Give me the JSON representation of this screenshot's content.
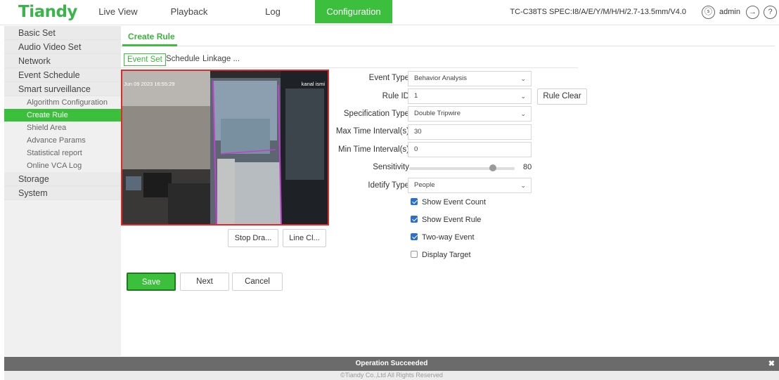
{
  "brand": {
    "logo": "Tiandy"
  },
  "nav": {
    "tabs": [
      {
        "label": "Live View"
      },
      {
        "label": "Playback"
      },
      {
        "label": "Log"
      },
      {
        "label": "Configuration"
      }
    ]
  },
  "header": {
    "device": "TC-C38TS SPEC:I8/A/E/Y/M/H/H/2.7-13.5mm/V4.0",
    "user": "admin"
  },
  "sidebar": {
    "items": [
      {
        "label": "Basic Set"
      },
      {
        "label": "Audio Video Set"
      },
      {
        "label": "Network"
      },
      {
        "label": "Event Schedule"
      },
      {
        "label": "Smart surveillance"
      }
    ],
    "subitems": [
      {
        "label": "Algorithm Configuration"
      },
      {
        "label": "Create Rule"
      },
      {
        "label": "Shield Area"
      },
      {
        "label": "Advance Params"
      },
      {
        "label": "Statistical report"
      },
      {
        "label": "Online VCA Log"
      }
    ],
    "bottom": [
      {
        "label": "Storage"
      },
      {
        "label": "System"
      }
    ]
  },
  "page": {
    "title": "Create Rule",
    "subtabs": [
      {
        "label": "Event Set"
      },
      {
        "label": "Schedule"
      },
      {
        "label": "Linkage ..."
      }
    ]
  },
  "video": {
    "timestamp": "Jun 09 2023 16:55:29",
    "channel_name": "kanal ismi"
  },
  "video_buttons": {
    "stop_draw": "Stop Dra...",
    "line_clear": "Line Cl..."
  },
  "form": {
    "event_type": {
      "label": "Event Type",
      "value": "Behavior Analysis"
    },
    "rule_id": {
      "label": "Rule ID",
      "value": "1"
    },
    "rule_clear": "Rule Clear",
    "spec_type": {
      "label": "Specification Type",
      "value": "Double Tripwire"
    },
    "max_interval": {
      "label": "Max Time Interval(s)",
      "value": "30"
    },
    "min_interval": {
      "label": "Min Time Interval(s)",
      "value": "0"
    },
    "sensitivity": {
      "label": "Sensitivity",
      "value": "80"
    },
    "identify_type": {
      "label": "Idetify Type",
      "value": "People"
    },
    "checks": [
      {
        "label": "Show Event Count",
        "checked": true
      },
      {
        "label": "Show Event Rule",
        "checked": true
      },
      {
        "label": "Two-way Event",
        "checked": true
      },
      {
        "label": "Display Target",
        "checked": false
      }
    ]
  },
  "actions": {
    "save": "Save",
    "next": "Next",
    "cancel": "Cancel"
  },
  "status": {
    "message": "Operation Succeeded",
    "close": "✖"
  },
  "footer": {
    "copyright": "©Tiandy Co.,Ltd All Rights Reserved"
  },
  "colors": {
    "accent": "#3cbf3c",
    "highlight_border": "#e02a2a",
    "tripwire": "#c040d0"
  }
}
